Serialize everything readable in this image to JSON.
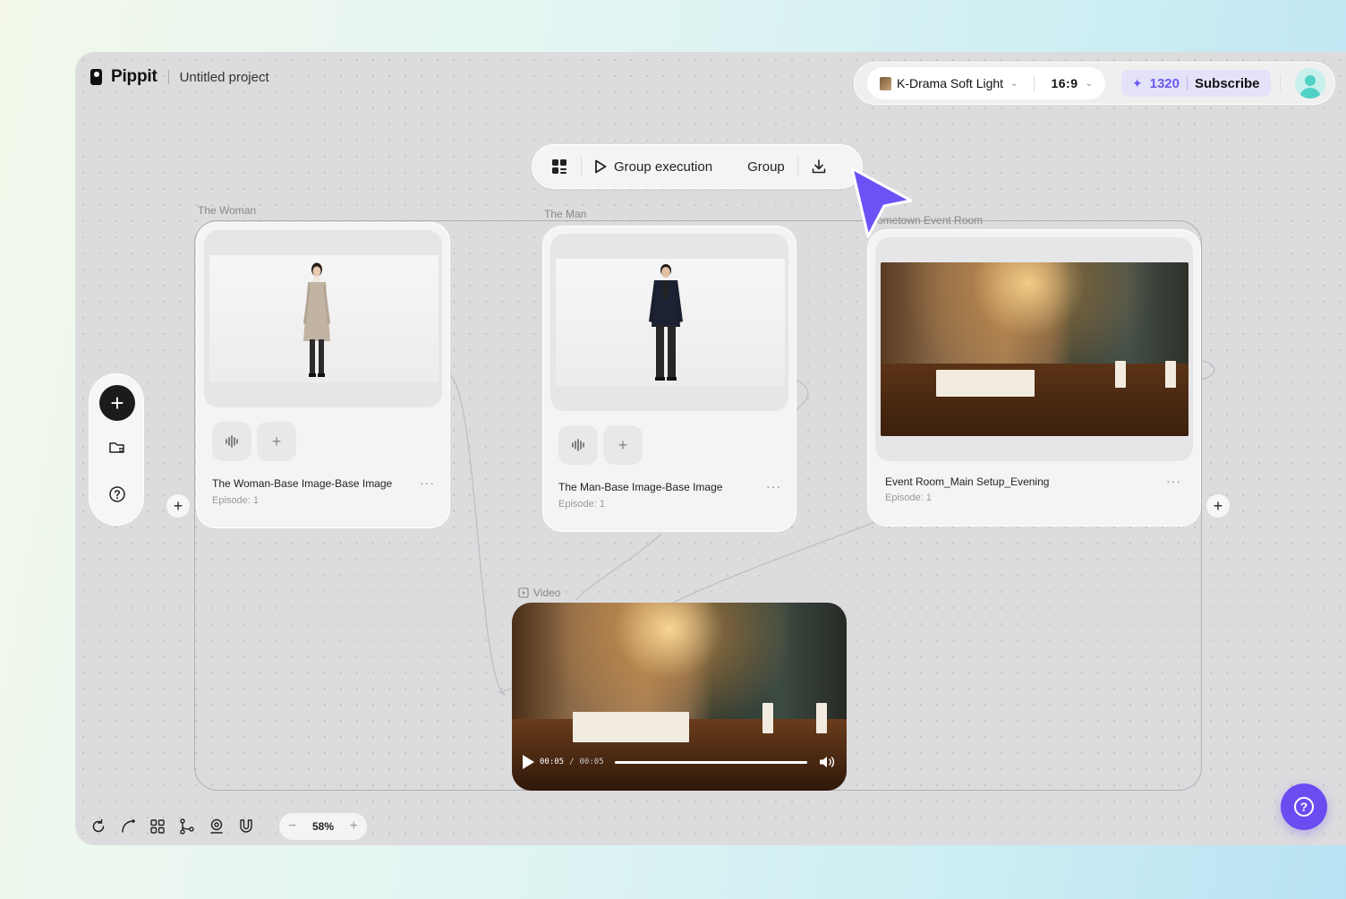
{
  "header": {
    "brand": "Pippit",
    "project_name": "Untitled project"
  },
  "top_right": {
    "style_name": "K-Drama Soft Light",
    "aspect_ratio": "16:9",
    "credits": "1320",
    "subscribe_label": "Subscribe"
  },
  "toolbar": {
    "group_execution_label": "Group execution",
    "group_label": "Group"
  },
  "nodes": {
    "woman": {
      "group_label": "The Woman",
      "title": "The Woman-Base Image-Base Image",
      "episode": "Episode: 1"
    },
    "man": {
      "group_label": "The Man",
      "title": "The Man-Base Image-Base Image",
      "episode": "Episode: 1"
    },
    "room": {
      "group_label": "ometown Event Room",
      "title": "Event Room_Main Setup_Evening",
      "episode": "Episode: 1"
    },
    "video": {
      "label": "Video",
      "current_time": "00:05",
      "separator": "/",
      "duration": "00:05",
      "progress": 1.0
    }
  },
  "bottom": {
    "zoom_level": "58%"
  },
  "colors": {
    "accent": "#6b4cf0",
    "credit_text": "#6a5af0",
    "canvas": "#dcdcde"
  }
}
